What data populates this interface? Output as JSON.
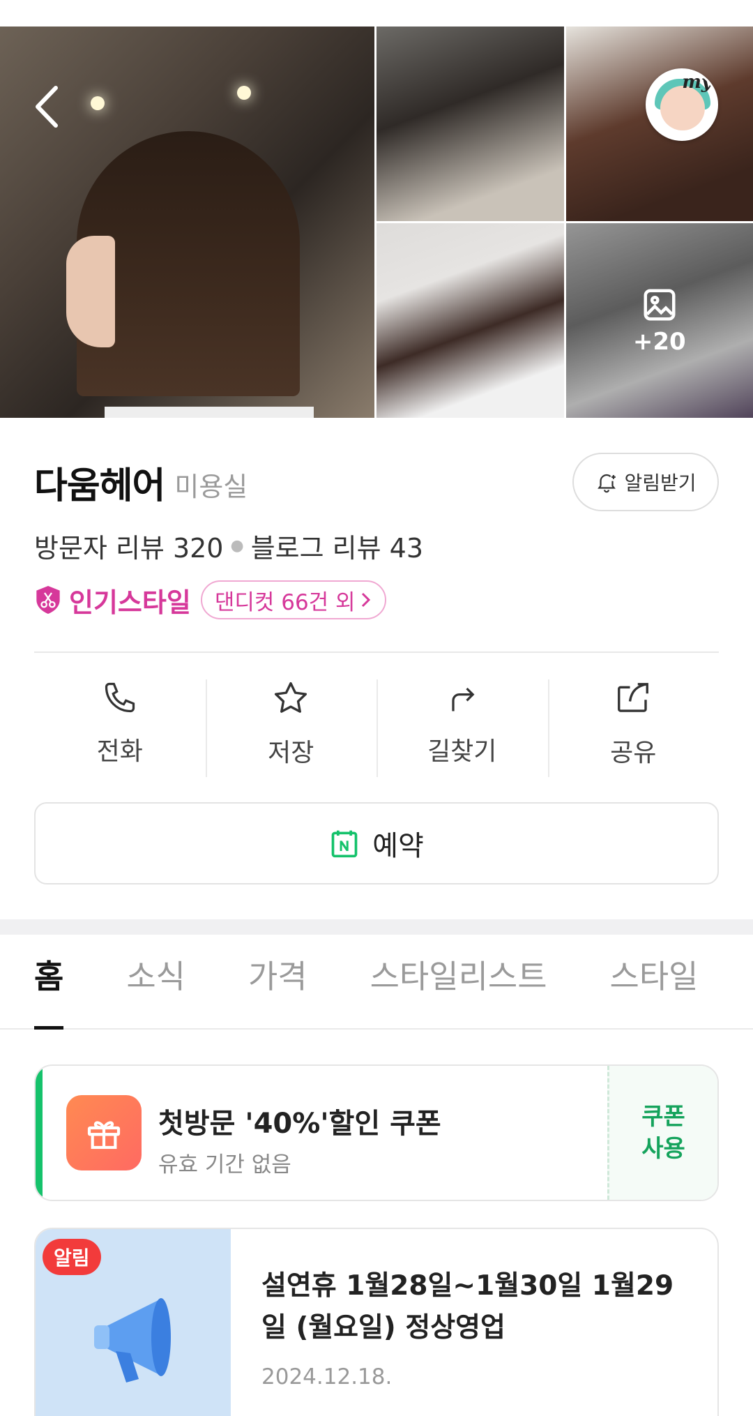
{
  "gallery": {
    "more_count": "+20",
    "my_label": "my"
  },
  "shop": {
    "name": "다움헤어",
    "category": "미용실",
    "alert_label": "알림받기",
    "visitor_reviews": "방문자 리뷰 320",
    "blog_reviews": "블로그 리뷰 43",
    "popular_label": "인기스타일",
    "popular_chip": "댄디컷 66건 외"
  },
  "actions": [
    {
      "label": "전화",
      "icon": "phone-icon"
    },
    {
      "label": "저장",
      "icon": "star-icon"
    },
    {
      "label": "길찾기",
      "icon": "directions-icon"
    },
    {
      "label": "공유",
      "icon": "share-icon"
    }
  ],
  "reserve_label": "예약",
  "tabs": [
    "홈",
    "소식",
    "가격",
    "스타일리스트",
    "스타일"
  ],
  "coupon": {
    "title": "첫방문 '40%'할인 쿠폰",
    "subtitle": "유효 기간 없음",
    "use_line1": "쿠폰",
    "use_line2": "사용"
  },
  "notice": {
    "badge": "알림",
    "title": "설연휴 1월28일~1월30일 1월29일 (월요일) 정상영업",
    "date": "2024.12.18."
  },
  "colors": {
    "brand_green": "#15c26b",
    "popular_pink": "#d6389a",
    "badge_red": "#f23b3b"
  }
}
